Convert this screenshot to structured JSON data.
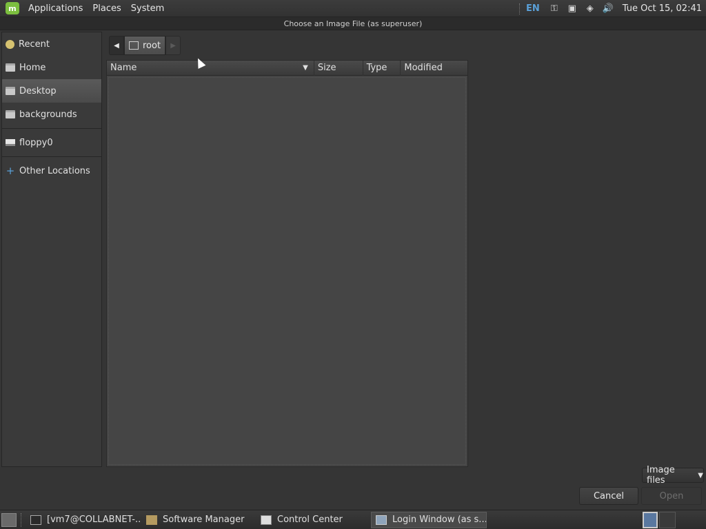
{
  "top_panel": {
    "menus": [
      "Applications",
      "Places",
      "System"
    ],
    "tray": {
      "keyboard_layout": "EN",
      "icons": [
        "key-icon",
        "network-icon",
        "shield-icon",
        "volume-icon"
      ]
    },
    "clock": "Tue Oct 15, 02:41"
  },
  "window": {
    "title": "Choose an Image File (as superuser)"
  },
  "sidebar": {
    "items": [
      {
        "label": "Recent",
        "icon": "recent-icon",
        "active": false
      },
      {
        "label": "Home",
        "icon": "home-folder-icon",
        "active": false
      },
      {
        "label": "Desktop",
        "icon": "desktop-folder-icon",
        "active": true
      },
      {
        "label": "backgrounds",
        "icon": "folder-icon",
        "active": false
      },
      {
        "label": "floppy0",
        "icon": "floppy-icon",
        "active": false
      },
      {
        "label": "Other Locations",
        "icon": "plus-icon",
        "active": false
      }
    ]
  },
  "path_bar": {
    "current": "root"
  },
  "file_list": {
    "columns": [
      "Name",
      "Size",
      "Type",
      "Modified"
    ]
  },
  "footer": {
    "filter": "Image files",
    "cancel": "Cancel",
    "open": "Open"
  },
  "taskbar": {
    "items": [
      {
        "label": "[vm7@COLLABNET-...",
        "icon": "terminal-icon",
        "active": false
      },
      {
        "label": "Software Manager",
        "icon": "software-manager-icon",
        "active": false
      },
      {
        "label": "Control Center",
        "icon": "control-center-icon",
        "active": false
      },
      {
        "label": "Login Window (as s...",
        "icon": "login-window-icon",
        "active": true
      }
    ]
  },
  "colors": {
    "accent": "#5aa0d8",
    "mint": "#7cbf3f"
  }
}
